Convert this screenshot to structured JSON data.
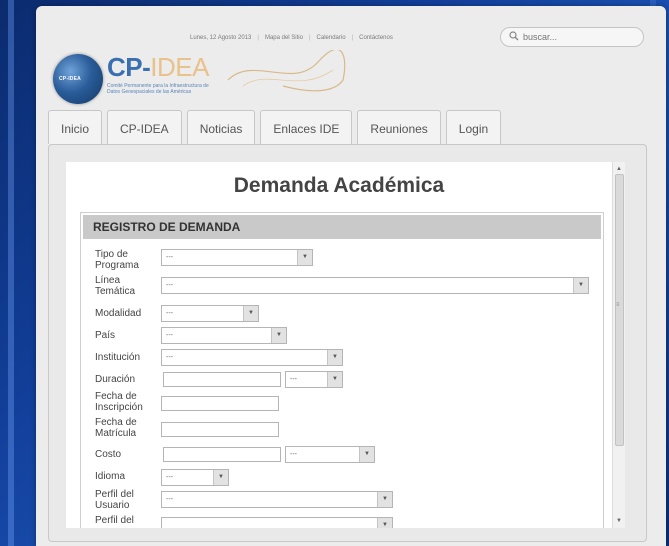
{
  "topbar": {
    "date": "Lunes, 12 Agosto 2013",
    "links": [
      "Mapa del Sitio",
      "Calendario",
      "Contáctenos"
    ]
  },
  "search": {
    "placeholder": "buscar..."
  },
  "logo": {
    "globe_text": "CP-IDEA",
    "title_cp": "CP-",
    "title_idea": "IDEA",
    "subtitle_line1": "Comité Permanente para la Infraestructura de",
    "subtitle_line2": "Datos Geoespaciales de las Américas"
  },
  "tabs": [
    "Inicio",
    "CP-IDEA",
    "Noticias",
    "Enlaces IDE",
    "Reuniones",
    "Login"
  ],
  "page": {
    "title": "Demanda Académica"
  },
  "form": {
    "section_title": "REGISTRO DE DEMANDA",
    "default_option": "---",
    "fields": {
      "tipo_programa": "Tipo de Programa",
      "linea_tematica": "Línea Temática",
      "modalidad": "Modalidad",
      "pais": "País",
      "institucion": "Institución",
      "duracion": "Duración",
      "fecha_inscripcion": "Fecha de Inscripción",
      "fecha_matricula": "Fecha de Matrícula",
      "costo": "Costo",
      "idioma": "Idioma",
      "perfil_usuario": "Perfil del Usuario",
      "perfil_del": "Perfil del"
    }
  },
  "colors": {
    "background": "#123f9a",
    "frame": "#ececec",
    "section_header": "#c9c9c9",
    "logo_blue": "#3a6fb0",
    "logo_gold": "#e8c28a"
  }
}
